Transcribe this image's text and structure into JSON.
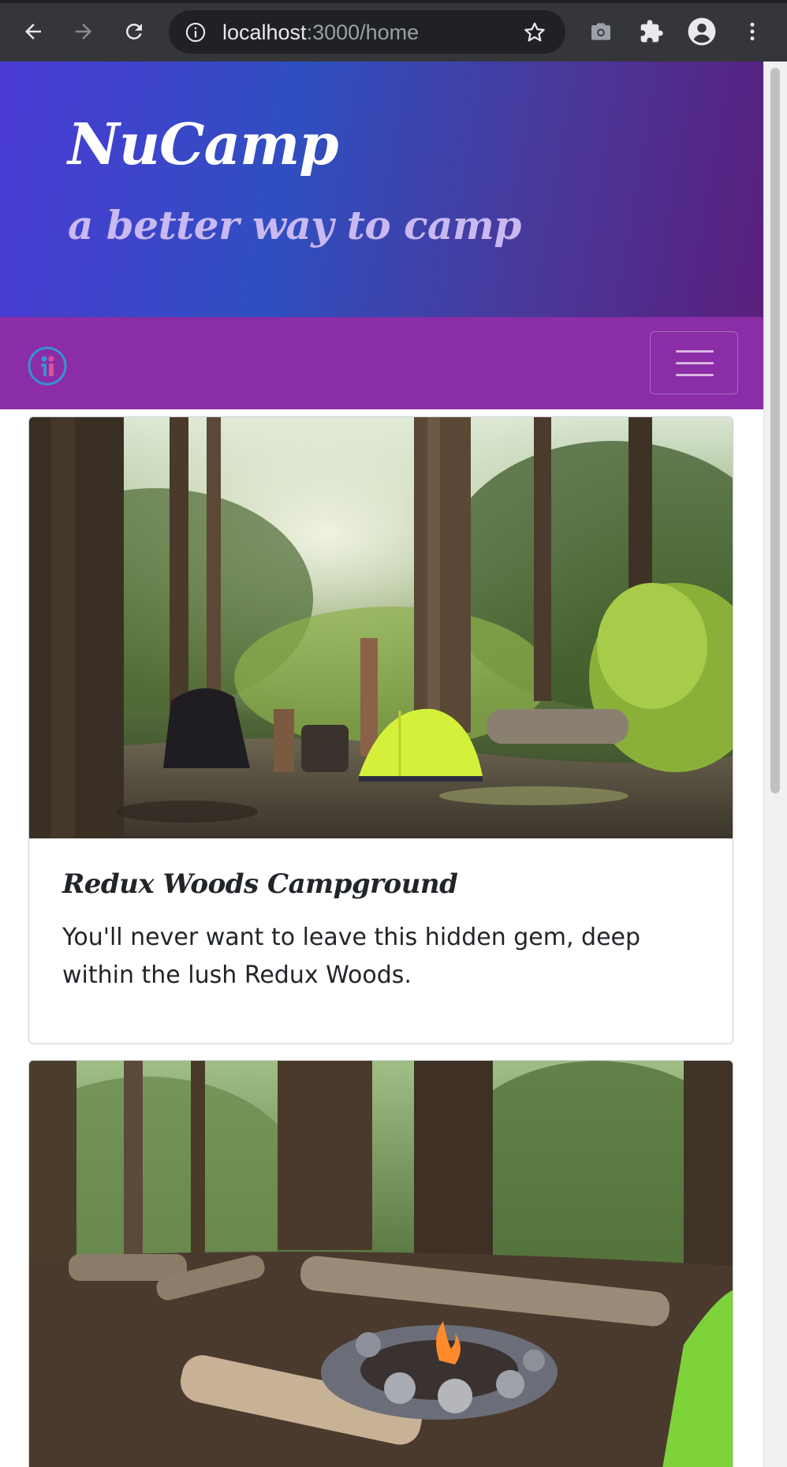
{
  "browser": {
    "url_host": "localhost",
    "url_path": ":3000/home"
  },
  "header": {
    "title": "NuCamp",
    "subtitle": "a better way to camp"
  },
  "cards": [
    {
      "title": "Redux Woods Campground",
      "text": "You'll never want to leave this hidden gem, deep within the lush Redux Woods."
    }
  ],
  "colors": {
    "jumbotron_start": "#4b3ad4",
    "jumbotron_end": "#5a1f7d",
    "navbar": "#8a2da6"
  },
  "icons": {
    "back": "arrow-left-icon",
    "forward": "arrow-right-icon",
    "reload": "reload-icon",
    "info": "info-icon",
    "bookmark": "star-icon",
    "camera": "camera-icon",
    "extensions": "puzzle-icon",
    "profile": "profile-icon",
    "menu": "kebab-menu-icon",
    "logo": "nucamp-logo-icon",
    "toggler": "hamburger-icon"
  }
}
